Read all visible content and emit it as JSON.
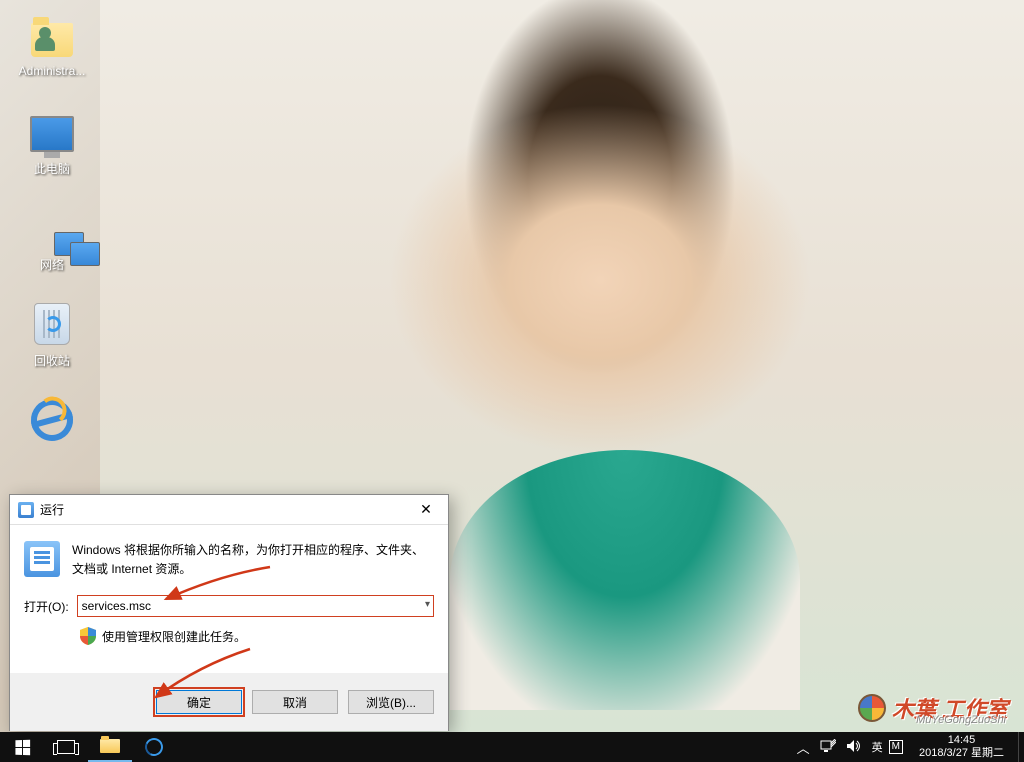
{
  "desktop": {
    "icons": [
      {
        "name": "administrator-folder",
        "label": "Administra..."
      },
      {
        "name": "this-pc",
        "label": "此电脑"
      },
      {
        "name": "network",
        "label": "网络"
      },
      {
        "name": "recycle-bin",
        "label": "回收站"
      },
      {
        "name": "internet-explorer",
        "label": ""
      }
    ]
  },
  "run": {
    "title": "运行",
    "description": "Windows 将根据你所输入的名称，为你打开相应的程序、文件夹、文档或 Internet 资源。",
    "open_label": "打开(O):",
    "open_value": "services.msc",
    "admin_text": "使用管理权限创建此任务。",
    "ok": "确定",
    "cancel": "取消",
    "browse": "浏览(B)..."
  },
  "watermark": {
    "text": "木葉 工作室",
    "sub": "MuYeGongZuoShi"
  },
  "taskbar": {
    "ime_lang": "英",
    "ime_mode": "M",
    "time": "14:45",
    "date": "2018/3/27 星期二"
  }
}
